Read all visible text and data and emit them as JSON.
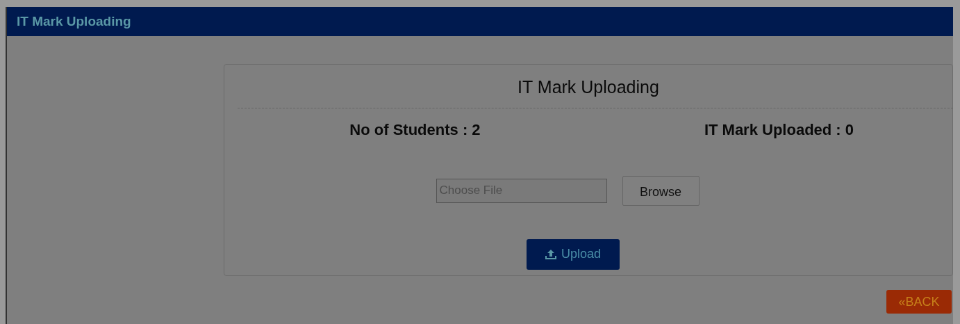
{
  "header": {
    "title": "IT Mark Uploading"
  },
  "card": {
    "title": "IT Mark Uploading",
    "stats": [
      {
        "label": "No of Students : 2"
      },
      {
        "label": "IT Mark Uploaded : 0"
      }
    ],
    "file_field": {
      "placeholder": "Choose File"
    },
    "browse_button": "Browse",
    "upload_button": "Upload"
  },
  "back_button": "«BACK"
}
